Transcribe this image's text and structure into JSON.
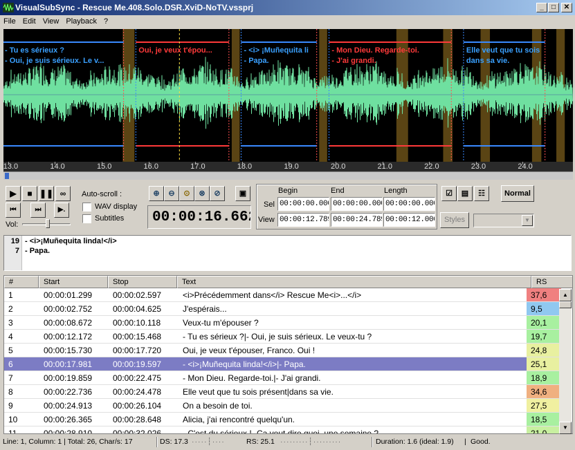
{
  "window": {
    "title": "VisualSubSync - Rescue Me.408.Solo.DSR.XviD-NoTV.vssprj",
    "min": "_",
    "max": "□",
    "close": "✕"
  },
  "menu": [
    "File",
    "Edit",
    "View",
    "Playback",
    "?"
  ],
  "waveform": {
    "subs": [
      {
        "l1": "- Tu es sérieux ?",
        "l2": "- Oui, je suis sérieux. Le v...",
        "color": "#3aa0ff"
      },
      {
        "l1": "Oui, je veux t'épou...",
        "l2": "",
        "color": "#ff3a3a"
      },
      {
        "l1": "- <i> ¡Muñequita li",
        "l2": "- Papa.",
        "color": "#3aa0ff"
      },
      {
        "l1": "- Mon Dieu. Regarde-toi.",
        "l2": "- J'ai grandi.",
        "color": "#ff3a3a"
      },
      {
        "l1": "Elle veut que tu sois",
        "l2": "dans sa vie.",
        "color": "#3aa0ff"
      }
    ],
    "ticks": [
      "13.0",
      "14.0",
      "15.0",
      "16.0",
      "17.0",
      "18.0",
      "19.0",
      "20.0",
      "21.0",
      "22.0",
      "23.0",
      "24.0"
    ]
  },
  "controls": {
    "autoscroll_label": "Auto-scroll :",
    "wav_display": "WAV display",
    "subtitles": "Subtitles",
    "vol": "Vol:",
    "time": "00:00:16.662",
    "begin": "Begin",
    "end": "End",
    "length": "Length",
    "sel": "Sel",
    "view": "View",
    "sel_begin": "00:00:00.000",
    "sel_end": "00:00:00.000",
    "sel_length": "00:00:00.000",
    "view_begin": "00:00:12.789",
    "view_end": "00:00:24.789",
    "view_length": "00:00:12.000",
    "styles": "Styles",
    "normal": "Normal"
  },
  "editor": {
    "num1": "19",
    "num2": "7",
    "line1": "- <i>¡Muñequita linda!</i>",
    "line2": "- Papa."
  },
  "grid": {
    "headers": [
      "#",
      "Start",
      "Stop",
      "Text",
      "RS"
    ],
    "rows": [
      {
        "n": "1",
        "start": "00:00:01.299",
        "stop": "00:00:02.597",
        "text": "<i>Précédemment dans</i> Rescue Me<i>...</i>",
        "rs": "37,6",
        "rsColor": "#f08080"
      },
      {
        "n": "2",
        "start": "00:00:02.752",
        "stop": "00:00:04.625",
        "text": "J'espérais...",
        "rs": "9,5",
        "rsColor": "#90c8f0"
      },
      {
        "n": "3",
        "start": "00:00:08.672",
        "stop": "00:00:10.118",
        "text": "Veux-tu m'épouser ?",
        "rs": "20,1",
        "rsColor": "#a8f0a0"
      },
      {
        "n": "4",
        "start": "00:00:12.172",
        "stop": "00:00:15.468",
        "text": "- Tu es sérieux ?|- Oui, je suis sérieux. Le veux-tu ?",
        "rs": "19,7",
        "rsColor": "#a8f0a0"
      },
      {
        "n": "5",
        "start": "00:00:15.730",
        "stop": "00:00:17.720",
        "text": "Oui, je veux t'épouser, Franco. Oui !",
        "rs": "24,8",
        "rsColor": "#e8f0a0"
      },
      {
        "n": "6",
        "start": "00:00:17.981",
        "stop": "00:00:19.597",
        "text": "- <i>¡Muñequita linda!</i>|- Papa.",
        "rs": "25,1",
        "rsColor": "#e8f0a0",
        "selected": true
      },
      {
        "n": "7",
        "start": "00:00:19.859",
        "stop": "00:00:22.475",
        "text": "- Mon Dieu. Regarde-toi.|- J'ai grandi.",
        "rs": "18,9",
        "rsColor": "#a8f0a0"
      },
      {
        "n": "8",
        "start": "00:00:22.736",
        "stop": "00:00:24.478",
        "text": "Elle veut que tu sois présent|dans sa vie.",
        "rs": "34,6",
        "rsColor": "#f0b080"
      },
      {
        "n": "9",
        "start": "00:00:24.913",
        "stop": "00:00:26.104",
        "text": "On a besoin de toi.",
        "rs": "27,5",
        "rsColor": "#f0f0a0"
      },
      {
        "n": "10",
        "start": "00:00:26.365",
        "stop": "00:00:28.648",
        "text": "Alicia, j'ai rencontré quelqu'un.",
        "rs": "18,5",
        "rsColor": "#a8f0a0"
      },
      {
        "n": "11",
        "start": "00:00:28.910",
        "stop": "00:00:32.026",
        "text": "- C'est du sérieux !- Ça veut dire quoi, une semaine ?",
        "rs": "21,0",
        "rsColor": "#c8f0a0"
      }
    ]
  },
  "status": {
    "pos": "Line: 1, Column: 1 | Total: 26, Char/s: 17",
    "ds": "DS: 17.3",
    "rs": "RS: 25.1",
    "duration": "Duration: 1.6 (ideal: 1.9)",
    "good": "Good."
  }
}
